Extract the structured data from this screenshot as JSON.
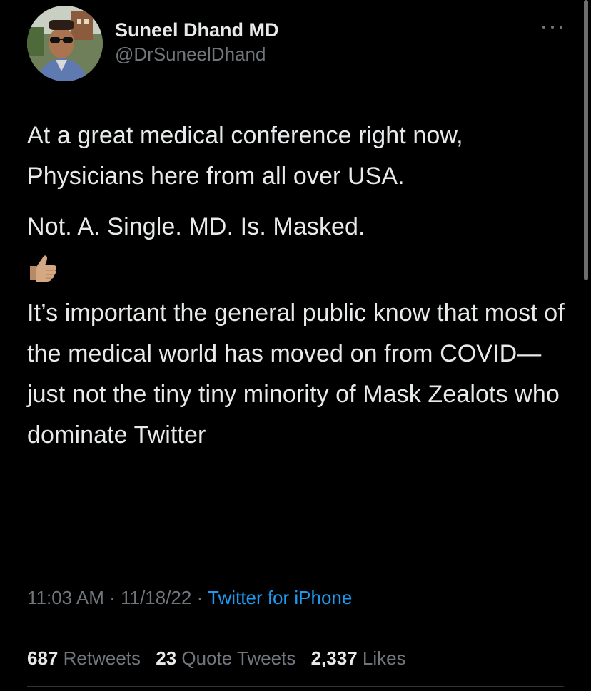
{
  "author": {
    "display_name": "Suneel Dhand MD",
    "handle": "@DrSuneelDhand",
    "avatar_icon": "profile-photo"
  },
  "tweet": {
    "paragraph_1": "At a great medical conference right now, Physicians here from all over USA.",
    "paragraph_2": "Not. A. Single. MD. Is. Masked.",
    "emoji_icon": "thumbs-up-icon",
    "paragraph_3": "It’s important the general public know that most of the medical world has moved on from COVID—just not the tiny tiny minority of Mask Zealots who dominate Twitter",
    "time": "11:03 AM",
    "date": "11/18/22",
    "separator": "·",
    "source": "Twitter for iPhone"
  },
  "stats": {
    "retweets_count": "687",
    "retweets_label": "Retweets",
    "quotes_count": "23",
    "quotes_label": "Quote Tweets",
    "likes_count": "2,337",
    "likes_label": "Likes"
  },
  "colors": {
    "background": "#000000",
    "text": "#e7e9ea",
    "secondary": "#71767b",
    "link": "#1d9bf0",
    "divider": "#2f3336"
  }
}
